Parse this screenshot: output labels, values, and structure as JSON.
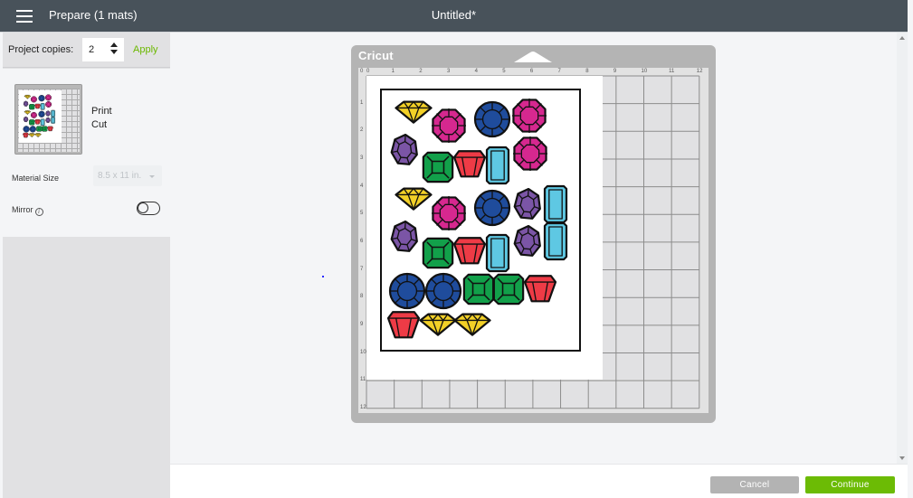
{
  "header": {
    "menu_icon": "hamburger-menu-icon",
    "title": "Prepare (1 mats)",
    "document_title": "Untitled*"
  },
  "left_panel": {
    "copies_label": "Project copies:",
    "copies_value": "2",
    "apply_label": "Apply",
    "mat": {
      "mode_lines": [
        "Print",
        "Cut"
      ]
    },
    "material_size_label": "Material Size",
    "material_size_value": "8.5 x 11 in.",
    "mirror_label": "Mirror",
    "mirror_info_icon": "i",
    "mirror_on": false
  },
  "canvas": {
    "mat_brand": "Cricut",
    "ruler_top": [
      "0",
      "1",
      "2",
      "3",
      "4",
      "5",
      "6",
      "7",
      "8",
      "9",
      "10",
      "11",
      "12"
    ],
    "ruler_left": [
      "0",
      "1",
      "2",
      "3",
      "4",
      "5",
      "6",
      "7",
      "8",
      "9",
      "10",
      "11",
      "12"
    ],
    "mat_size_in": [
      12,
      12
    ],
    "print_area_in": [
      8.5,
      11
    ],
    "gems": [
      {
        "shape": "diamond",
        "color": "#f2d027",
        "col": 0,
        "row": 0
      },
      {
        "shape": "octagon",
        "color": "#d6288f",
        "col": 1,
        "row": 0
      },
      {
        "shape": "round",
        "color": "#1f4c9c",
        "col": 2,
        "row": 0
      },
      {
        "shape": "octagon",
        "color": "#d6288f",
        "col": 3,
        "row": 0
      },
      {
        "shape": "hexagon",
        "color": "#7b55a6",
        "col": 0,
        "row": 1
      },
      {
        "shape": "square",
        "color": "#12a04a",
        "col": 1,
        "row": 1
      },
      {
        "shape": "cup",
        "color": "#ee3b46",
        "col": 2,
        "row": 1
      },
      {
        "shape": "emerald",
        "color": "#5ec8e3",
        "col": 3,
        "row": 1
      },
      {
        "shape": "octagon",
        "color": "#d6288f",
        "col": 4,
        "row": 1
      },
      {
        "shape": "diamond",
        "color": "#f2d027",
        "col": 0,
        "row": 2
      },
      {
        "shape": "octagon",
        "color": "#d6288f",
        "col": 1,
        "row": 2
      },
      {
        "shape": "round",
        "color": "#1f4c9c",
        "col": 2,
        "row": 2
      },
      {
        "shape": "hexagon",
        "color": "#7b55a6",
        "col": 3,
        "row": 2
      },
      {
        "shape": "emerald",
        "color": "#5ec8e3",
        "col": 4,
        "row": 2
      },
      {
        "shape": "hexagon",
        "color": "#7b55a6",
        "col": 0,
        "row": 3
      },
      {
        "shape": "square",
        "color": "#12a04a",
        "col": 1,
        "row": 3
      },
      {
        "shape": "cup",
        "color": "#ee3b46",
        "col": 2,
        "row": 3
      },
      {
        "shape": "emerald",
        "color": "#5ec8e3",
        "col": 3,
        "row": 3
      },
      {
        "shape": "hexagon",
        "color": "#7b55a6",
        "col": 4,
        "row": 3
      },
      {
        "shape": "emerald",
        "color": "#5ec8e3",
        "col": 5,
        "row": 3
      },
      {
        "shape": "round",
        "color": "#1f4c9c",
        "col": 0,
        "row": 4
      },
      {
        "shape": "round",
        "color": "#1f4c9c",
        "col": 1,
        "row": 4
      },
      {
        "shape": "square",
        "color": "#12a04a",
        "col": 2,
        "row": 4
      },
      {
        "shape": "square",
        "color": "#12a04a",
        "col": 3,
        "row": 4
      },
      {
        "shape": "cup",
        "color": "#ee3b46",
        "col": 4,
        "row": 4
      },
      {
        "shape": "cup",
        "color": "#ee3b46",
        "col": 0,
        "row": 5
      },
      {
        "shape": "diamond",
        "color": "#f2d027",
        "col": 1,
        "row": 5
      },
      {
        "shape": "diamond",
        "color": "#f2d027",
        "col": 2,
        "row": 5
      }
    ]
  },
  "footer": {
    "cancel_label": "Cancel",
    "continue_label": "Continue"
  },
  "colors": {
    "header_bg": "#48525a",
    "accent_green": "#6cbb05",
    "cancel_gray": "#b3b3b3"
  }
}
